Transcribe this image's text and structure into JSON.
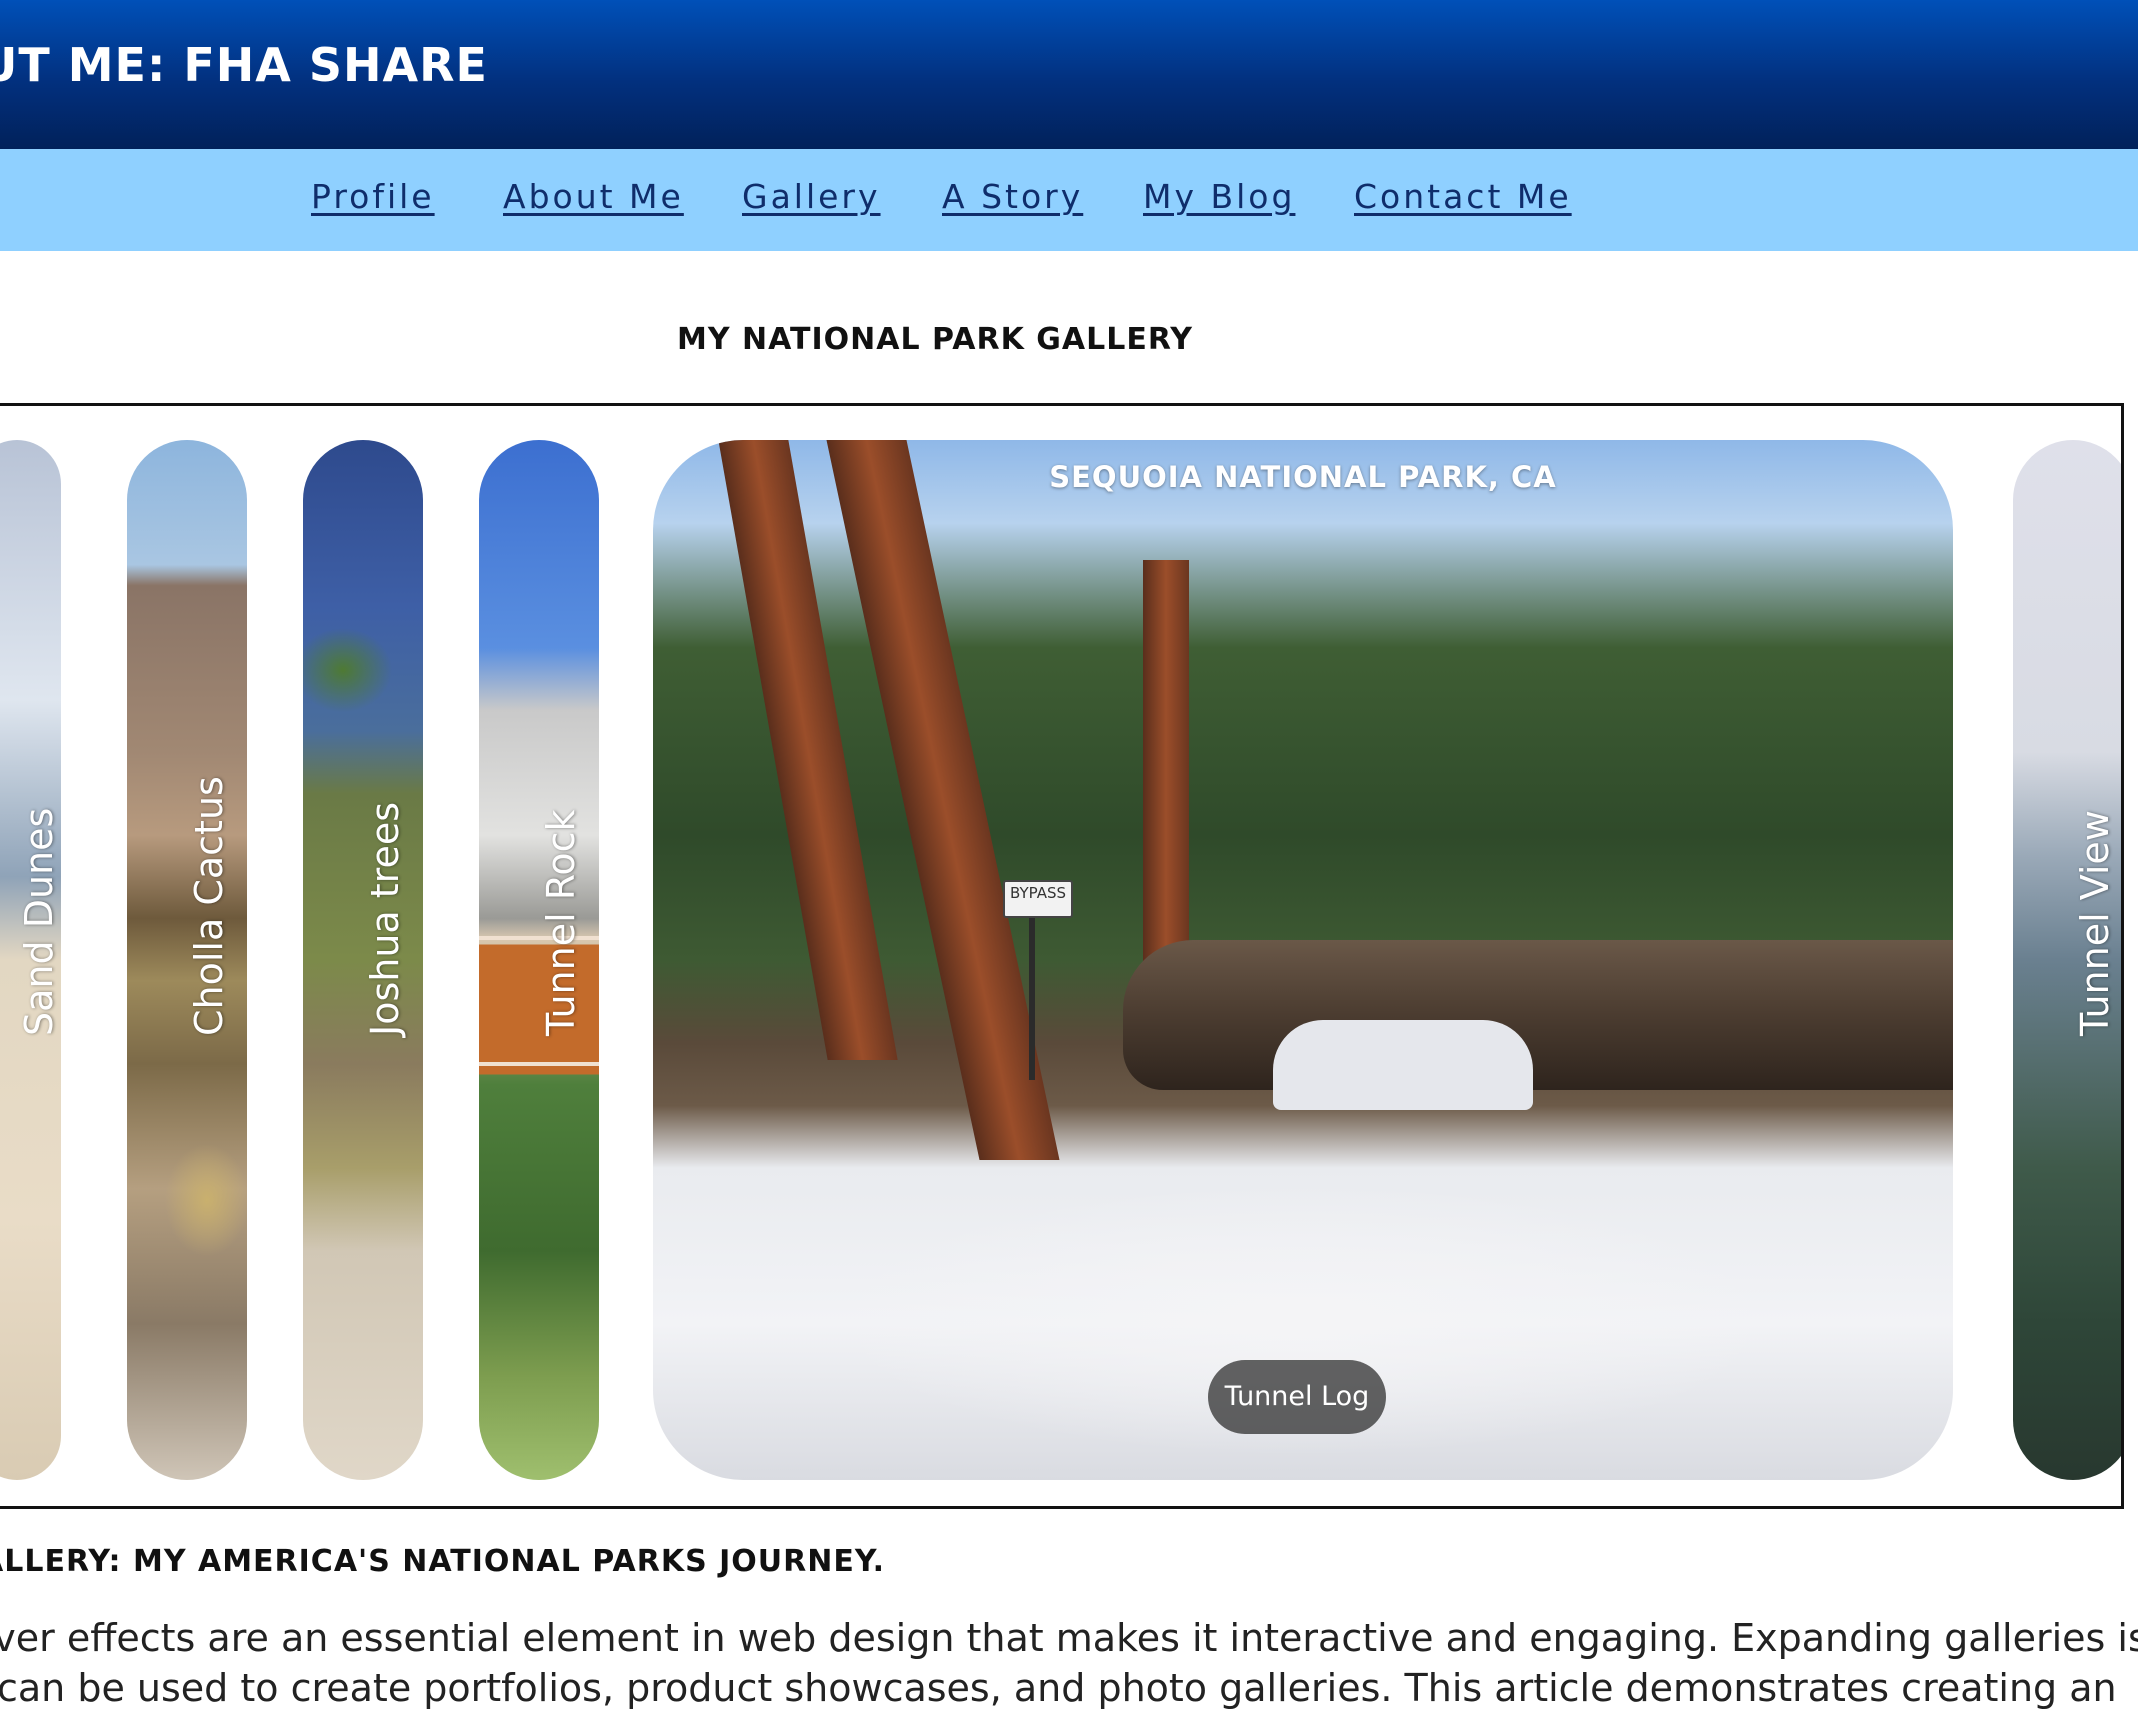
{
  "header": {
    "title": "ut me: fha share"
  },
  "nav": {
    "items": [
      {
        "label": "Profile"
      },
      {
        "label": "About Me"
      },
      {
        "label": "Gallery"
      },
      {
        "label": "A Story"
      },
      {
        "label": "My Blog"
      },
      {
        "label": "Contact Me"
      }
    ]
  },
  "gallery": {
    "title": "My National Park Gallery",
    "panels": [
      {
        "label": "Sand Dunes"
      },
      {
        "label": "Cholla Cactus"
      },
      {
        "label": "Joshua trees"
      },
      {
        "label": "Tunnel Rock"
      },
      {
        "label": "Tunnel Log",
        "title": "Sequoia National Park, CA",
        "sign_text": "BYPASS"
      },
      {
        "label": "Tunnel View"
      }
    ]
  },
  "article": {
    "heading": "allery: My America's National Parks Journey.",
    "lines": [
      "over effects are an essential element in web design that makes it interactive and engaging. Expanding galleries is a",
      "t can be used to create portfolios, product showcases, and photo galleries. This article demonstrates creating an"
    ]
  }
}
